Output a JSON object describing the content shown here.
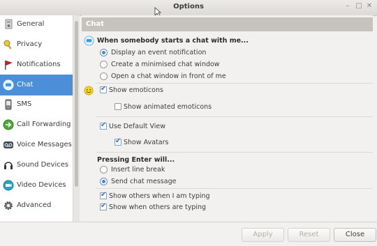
{
  "window": {
    "title": "Options"
  },
  "sidebar": {
    "items": [
      {
        "label": "General",
        "icon": "general-icon"
      },
      {
        "label": "Privacy",
        "icon": "privacy-icon"
      },
      {
        "label": "Notifications",
        "icon": "notifications-icon"
      },
      {
        "label": "Chat",
        "icon": "chat-icon",
        "active": true
      },
      {
        "label": "SMS",
        "icon": "sms-icon"
      },
      {
        "label": "Call Forwarding",
        "icon": "call-forwarding-icon"
      },
      {
        "label": "Voice Messages",
        "icon": "voice-messages-icon"
      },
      {
        "label": "Sound Devices",
        "icon": "sound-devices-icon"
      },
      {
        "label": "Video Devices",
        "icon": "video-devices-icon"
      },
      {
        "label": "Advanced",
        "icon": "advanced-icon"
      }
    ]
  },
  "content": {
    "header": "Chat",
    "start_chat": {
      "title": "When somebody starts a chat with me...",
      "options": [
        "Display an event notification",
        "Create a minimised chat window",
        "Open a chat window in front of me"
      ],
      "selected": 0
    },
    "emoticons": {
      "show": "Show emoticons",
      "animated": "Show animated emoticons"
    },
    "view": {
      "default": "Use Default View",
      "avatars": "Show Avatars"
    },
    "enter": {
      "title": "Pressing Enter will...",
      "options": [
        "Insert line break",
        "Send chat message"
      ],
      "selected": 1
    },
    "typing": {
      "others_typing_me": "Show others when I am typing",
      "others_typing": "Show when others are typing"
    }
  },
  "footer": {
    "apply": "Apply",
    "reset": "Reset",
    "close": "Close"
  },
  "colors": {
    "accent": "#4a8fd8",
    "header": "#c6c3bf"
  }
}
